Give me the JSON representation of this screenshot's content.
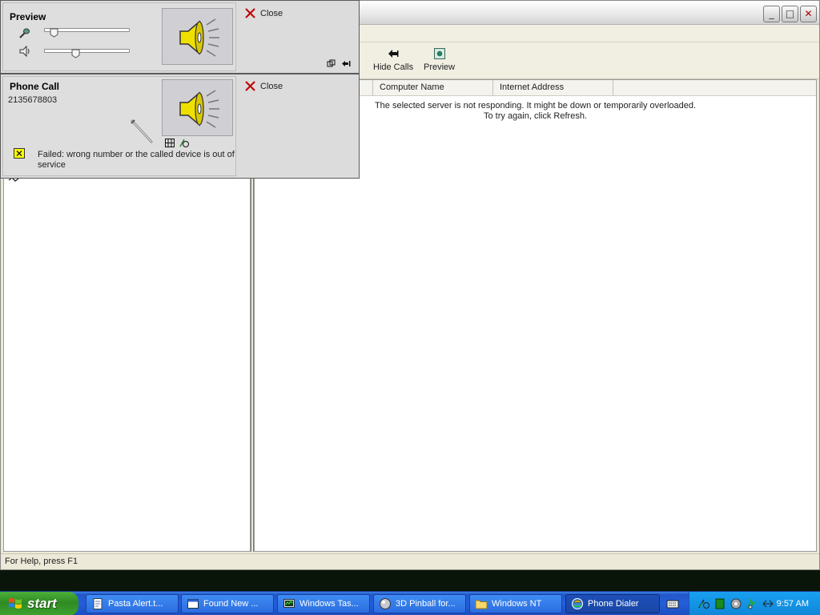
{
  "window": {
    "title": "",
    "controls": {
      "minimize": "_",
      "maximize": "□",
      "close": "✕"
    }
  },
  "toolbar": {
    "hide_calls_label": "Hide Calls",
    "preview_label": "Preview"
  },
  "list": {
    "columns": [
      "Computer Name",
      "Internet Address"
    ],
    "message_line1": "The selected server is not responding. It might be down or temporarily overloaded.",
    "message_line2": "To try again, click Refresh."
  },
  "statusbar": {
    "text": "For Help, press F1"
  },
  "preview_panel": {
    "title": "Preview",
    "close_label": "Close",
    "microphone_level": 0.05,
    "speaker_level": 0.35
  },
  "call_panel": {
    "title": "Phone Call",
    "number": "2135678803",
    "close_label": "Close",
    "status": "Failed:  wrong number or the called device is out of service"
  },
  "taskbar": {
    "start_label": "start",
    "items": [
      {
        "label": "Pasta Alert.t...",
        "icon": "document-icon"
      },
      {
        "label": "Found New ...",
        "icon": "window-icon"
      },
      {
        "label": "Windows Tas...",
        "icon": "task-manager-icon"
      },
      {
        "label": "3D Pinball for...",
        "icon": "pinball-icon"
      },
      {
        "label": "Windows NT",
        "icon": "folder-icon"
      },
      {
        "label": "Phone Dialer",
        "icon": "phone-dialer-icon"
      }
    ],
    "clock": "9:57 AM"
  },
  "colors": {
    "taskbar_blue": "#245edb",
    "start_green": "#3ea32f",
    "close_red": "#c00000",
    "status_yellow": "#ffff00"
  }
}
